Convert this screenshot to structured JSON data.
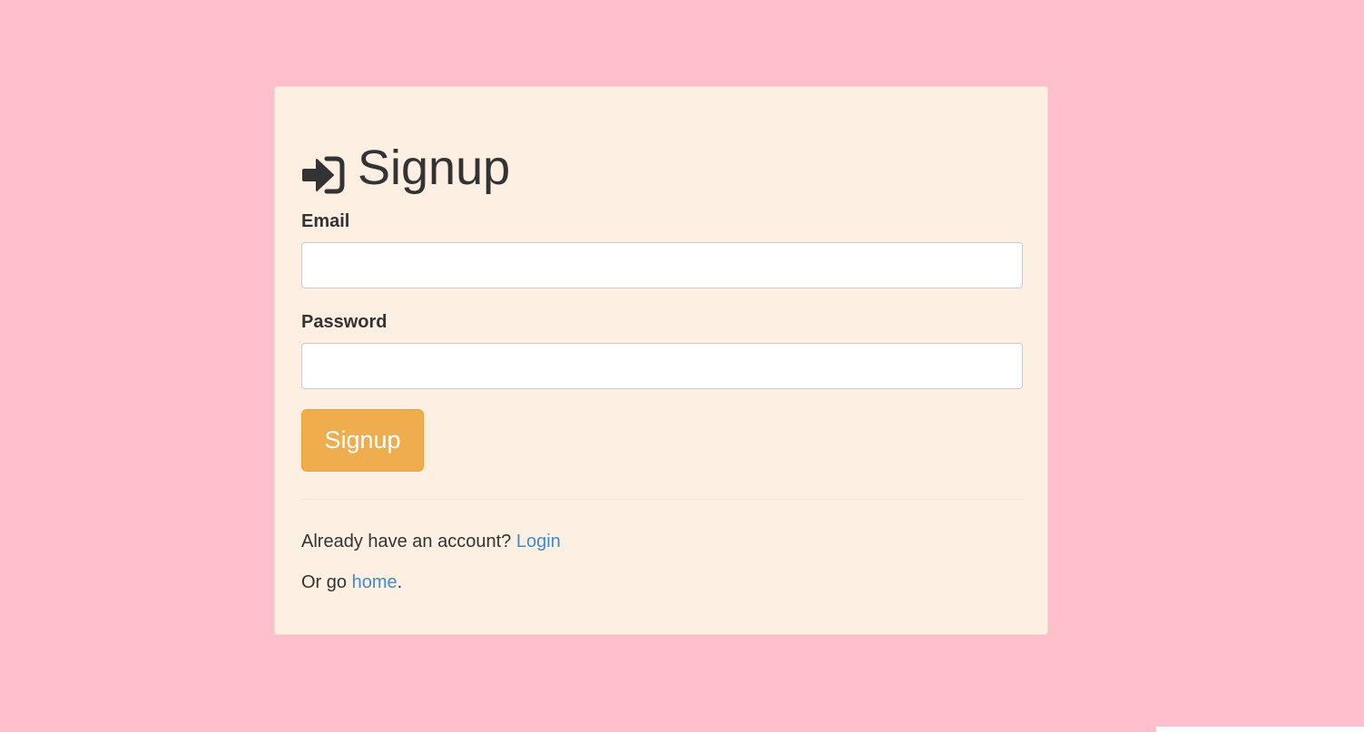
{
  "form": {
    "title": "Signup",
    "title_icon": "sign-in-icon",
    "email_label": "Email",
    "email_value": "",
    "password_label": "Password",
    "password_value": "",
    "submit_label": "Signup"
  },
  "footer": {
    "login_prompt": "Already have an account?",
    "login_link": "Login",
    "home_prefix": "Or go",
    "home_link": "home",
    "home_suffix": "."
  },
  "colors": {
    "page_background": "#ffc0cb",
    "card_background": "#fdf0e3",
    "button_background": "#f0ad4e",
    "link": "#428bca",
    "text": "#333333"
  }
}
